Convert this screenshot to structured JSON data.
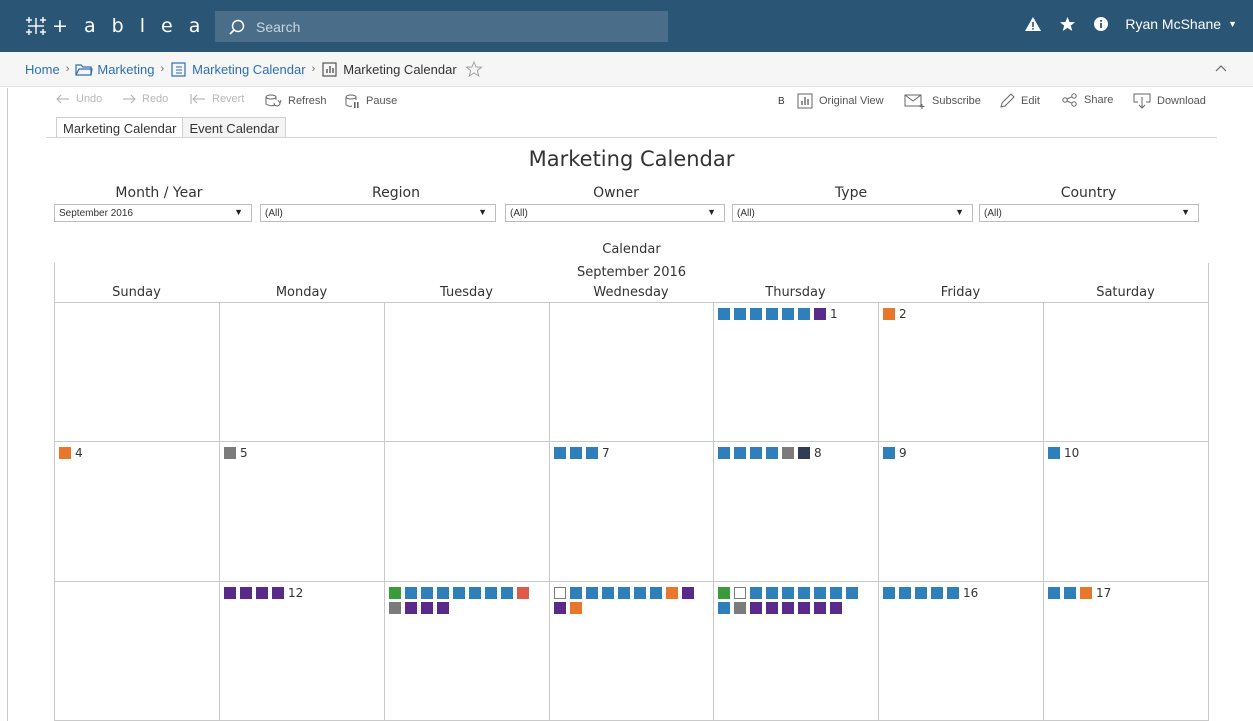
{
  "app": {
    "logo_text": "+ a b l e a u",
    "search_placeholder": "Search",
    "user_name": "Ryan McShane"
  },
  "breadcrumb": {
    "home": "Home",
    "project": "Marketing",
    "workbook": "Marketing Calendar",
    "view": "Marketing Calendar"
  },
  "toolbar": {
    "undo": "Undo",
    "redo": "Redo",
    "revert": "Revert",
    "refresh": "Refresh",
    "pause": "Pause",
    "b_label": "B",
    "original_view": "Original View",
    "subscribe": "Subscribe",
    "edit": "Edit",
    "share": "Share",
    "download": "Download"
  },
  "tabs": [
    "Marketing Calendar",
    "Event Calendar"
  ],
  "dashboard": {
    "title": "Marketing Calendar",
    "filters": [
      {
        "label": "Month / Year",
        "value": "September 2016"
      },
      {
        "label": "Region",
        "value": "(All)"
      },
      {
        "label": "Owner",
        "value": "(All)"
      },
      {
        "label": "Type",
        "value": "(All)"
      },
      {
        "label": "Country",
        "value": "(All)"
      }
    ],
    "calendar_title": "Calendar",
    "month_title": "September 2016",
    "weekdays": [
      "Sunday",
      "Monday",
      "Tuesday",
      "Wednesday",
      "Thursday",
      "Friday",
      "Saturday"
    ]
  },
  "colors": {
    "blue": "#2e7fba",
    "purple": "#5a2a8a",
    "orange": "#e8762b",
    "gray": "#7b7b7b",
    "navy": "#2f3e54",
    "green": "#3a9b3a",
    "red": "#e05a4a",
    "white": "#ffffff"
  },
  "calendar_days": [
    {
      "day": "1",
      "row": 0,
      "col": 4,
      "events": [
        "blue",
        "blue",
        "blue",
        "blue",
        "blue",
        "blue",
        "purple"
      ]
    },
    {
      "day": "2",
      "row": 0,
      "col": 5,
      "events": [
        "orange"
      ]
    },
    {
      "day": "4",
      "row": 1,
      "col": 0,
      "events": [
        "orange"
      ]
    },
    {
      "day": "5",
      "row": 1,
      "col": 1,
      "events": [
        "gray"
      ]
    },
    {
      "day": "7",
      "row": 1,
      "col": 3,
      "events": [
        "blue",
        "blue",
        "blue"
      ]
    },
    {
      "day": "8",
      "row": 1,
      "col": 4,
      "events": [
        "blue",
        "blue",
        "blue",
        "blue",
        "gray",
        "navy"
      ]
    },
    {
      "day": "9",
      "row": 1,
      "col": 5,
      "events": [
        "blue"
      ]
    },
    {
      "day": "10",
      "row": 1,
      "col": 6,
      "events": [
        "blue"
      ]
    },
    {
      "day": "12",
      "row": 2,
      "col": 1,
      "events": [
        "purple",
        "purple",
        "purple",
        "purple"
      ]
    },
    {
      "day": "",
      "row": 2,
      "col": 2,
      "events": [
        "green",
        "blue",
        "blue",
        "blue",
        "blue",
        "blue",
        "blue",
        "blue",
        "red",
        "gray",
        "purple",
        "purple",
        "purple"
      ]
    },
    {
      "day": "",
      "row": 2,
      "col": 3,
      "events": [
        "white",
        "blue",
        "blue",
        "blue",
        "blue",
        "blue",
        "blue",
        "orange",
        "purple",
        "purple",
        "orange"
      ]
    },
    {
      "day": "",
      "row": 2,
      "col": 4,
      "events": [
        "green",
        "white",
        "blue",
        "blue",
        "blue",
        "blue",
        "blue",
        "blue",
        "blue",
        "blue",
        "gray",
        "purple",
        "purple",
        "purple",
        "purple",
        "purple",
        "purple"
      ]
    },
    {
      "day": "16",
      "row": 2,
      "col": 5,
      "events": [
        "blue",
        "blue",
        "blue",
        "blue",
        "blue"
      ]
    },
    {
      "day": "17",
      "row": 2,
      "col": 6,
      "events": [
        "blue",
        "blue",
        "orange"
      ]
    }
  ]
}
